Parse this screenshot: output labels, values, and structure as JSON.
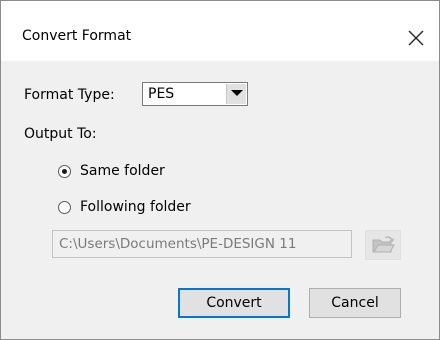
{
  "dialog": {
    "title": "Convert Format",
    "close_icon": "close-icon"
  },
  "format": {
    "label": "Format Type:",
    "selected": "PES"
  },
  "output": {
    "label": "Output To:",
    "options": [
      {
        "label": "Same folder",
        "checked": true
      },
      {
        "label": "Following folder",
        "checked": false
      }
    ],
    "path": "C:\\Users\\Documents\\PE-DESIGN 11",
    "browse_icon": "folder-open-icon"
  },
  "buttons": {
    "convert": "Convert",
    "cancel": "Cancel"
  },
  "colors": {
    "accent": "#0078d7",
    "dialog_bg": "#f0f0f0"
  }
}
